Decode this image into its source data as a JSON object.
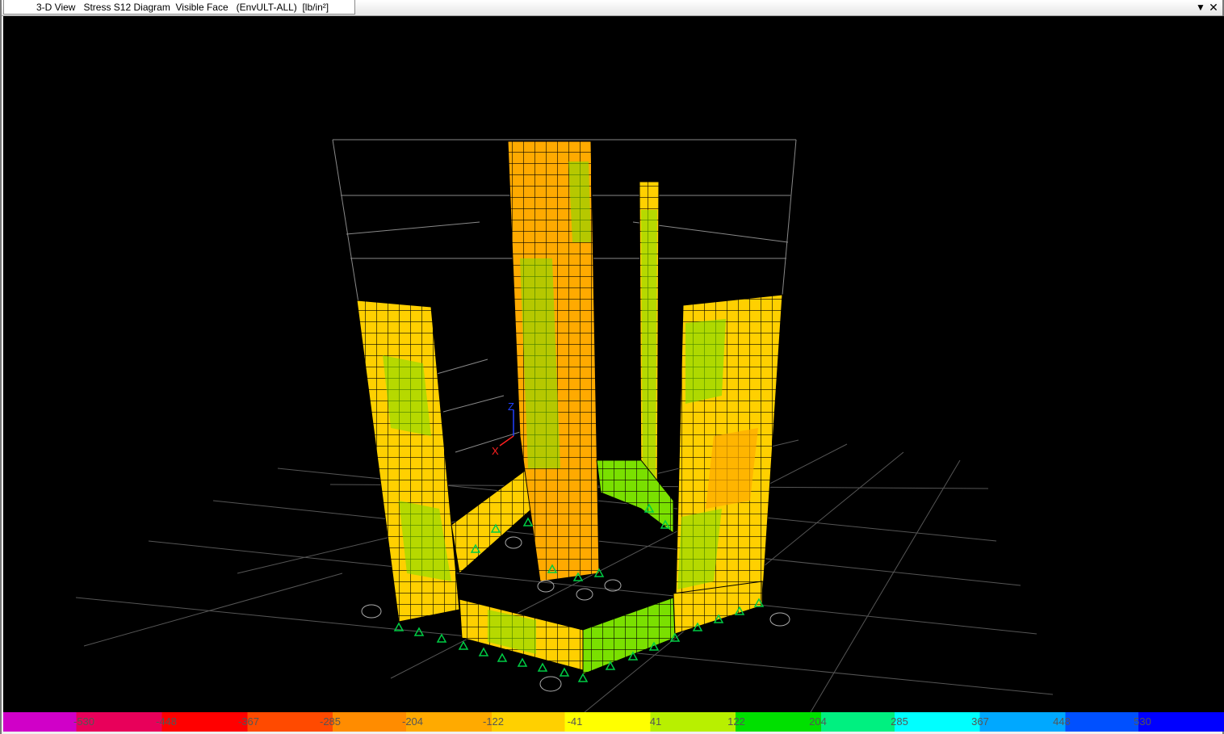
{
  "window": {
    "tab_title": "3-D View   Stress S12 Diagram  Visible Face   (EnvULT-ALL)  [lb/in²]",
    "dropdown_icon": "chevron-down-icon",
    "close_icon": "close-icon"
  },
  "axes": {
    "z": "Z",
    "x": "X"
  },
  "legend": {
    "values": [
      "-530",
      "-448",
      "-367",
      "-285",
      "-204",
      "-122",
      "-41",
      "41",
      "122",
      "204",
      "285",
      "367",
      "448",
      "530"
    ]
  },
  "colors": {
    "background": "#000000",
    "mesh_yellow": "#ffd000",
    "mesh_orange": "#ffaa00",
    "mesh_green": "#66e000",
    "support": "#00cc44"
  }
}
